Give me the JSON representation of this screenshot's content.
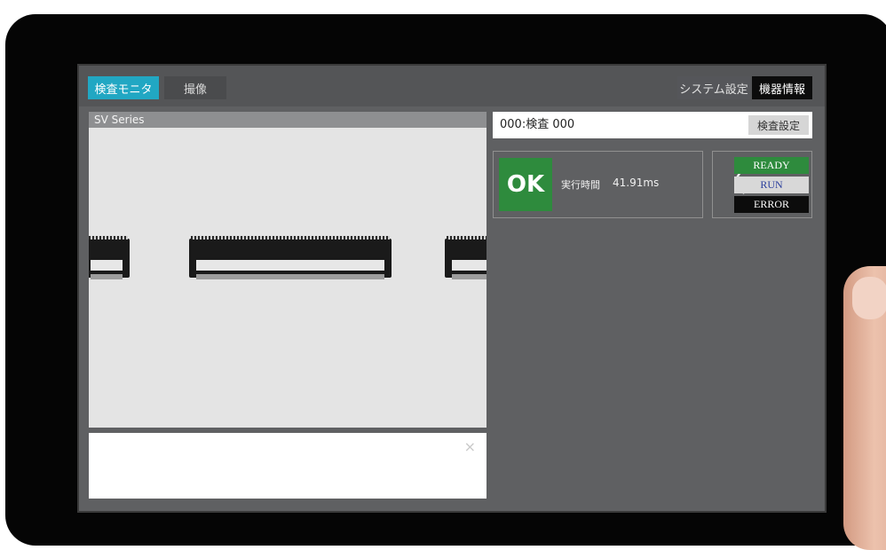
{
  "tabs": {
    "monitor": "検査モニタ",
    "capture": "撮像",
    "system_settings": "システム設定",
    "device_info": "機器情報"
  },
  "viewer": {
    "title": "SV Series"
  },
  "message": {
    "close_label": "×"
  },
  "program": {
    "name": "000:検査 000",
    "settings_button": "検査設定"
  },
  "result": {
    "judgement": "OK",
    "exec_time_label": "実行時間",
    "exec_time_value": "41.91ms"
  },
  "status": {
    "ready": "READY",
    "run": "RUN",
    "error": "ERROR",
    "collapse_glyph": "〈"
  },
  "colors": {
    "accent_tab": "#21a7c3",
    "ok_green": "#2e8b3d",
    "run_text": "#2b3f9c"
  }
}
